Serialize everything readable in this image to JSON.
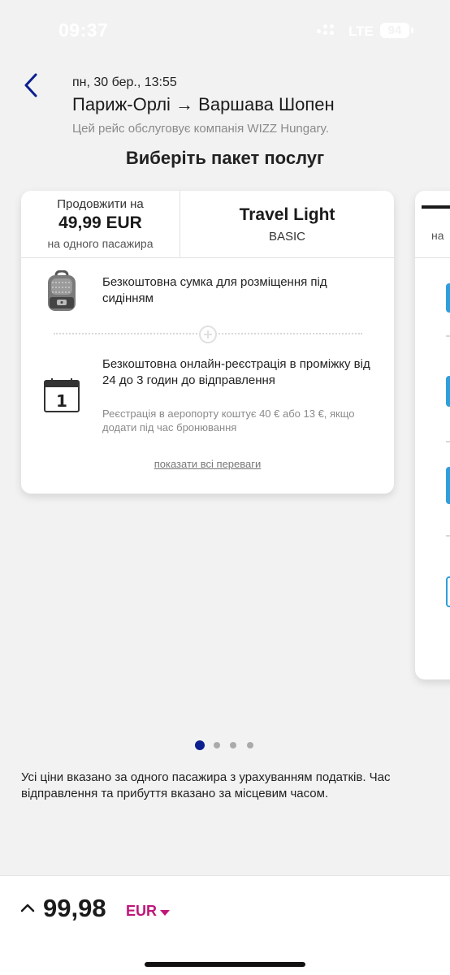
{
  "status_bar": {
    "time": "09:37",
    "network": "LTE",
    "battery": "94"
  },
  "header": {
    "date": "пн, 30 бер., 13:55",
    "route": "Париж-Орлі → Варшава Шопен",
    "operator": "Цей рейс обслуговує компанія WIZZ Hungary."
  },
  "page_title": "Виберіть пакет послуг",
  "card": {
    "price_label": "Продовжити на",
    "price": "49,99 EUR",
    "price_note": "на одного пасажира",
    "package_name": "Travel Light",
    "package_tier": "BASIC",
    "benefits": [
      {
        "icon": "backpack-icon",
        "text": "Безкоштовна сумка для розміщення під сидінням"
      },
      {
        "icon": "calendar-icon",
        "text": "Безкоштовна онлайн-реєстрація в проміжку від 24 до 3 годин до відправлення",
        "note": "Реєстрація в аеропорту коштує 40 € або 13 €, якщо додати під час бронювання"
      }
    ],
    "show_all": "показати всі переваги"
  },
  "peek_card": {
    "price_note": "на"
  },
  "pager": {
    "count": 4,
    "active": 0
  },
  "disclaimer": "Усі ціни вказано за одного пасажира з урахуванням податків. Час відправлення та прибуття вказано за місцевим часом.",
  "footer": {
    "total": "99,98",
    "currency": "EUR"
  },
  "colors": {
    "primary": "#0b1f8f",
    "accent": "#c0157a",
    "background": "#f2f2f2"
  }
}
